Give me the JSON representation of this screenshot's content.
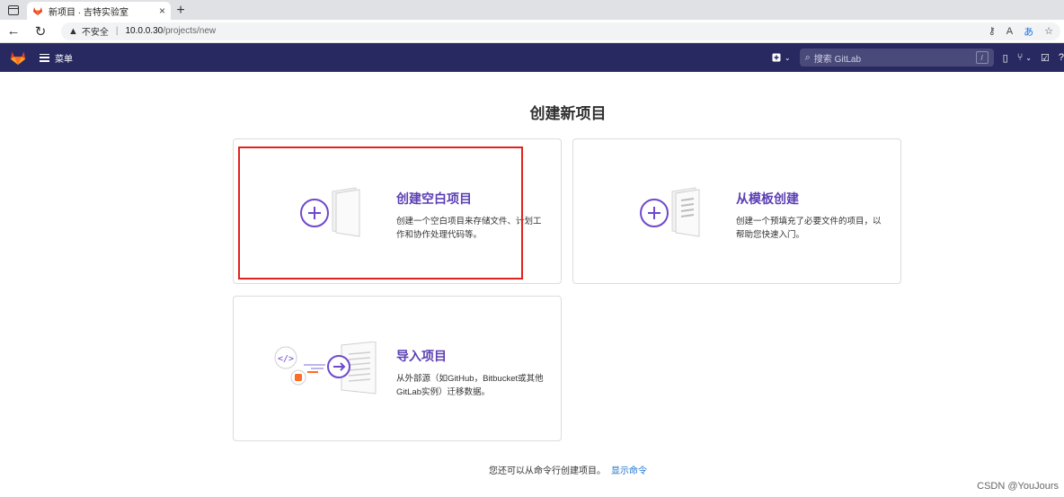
{
  "browser": {
    "tab_title": "新项目 · 吉特实验室",
    "new_tab_symbol": "+",
    "close_symbol": "×",
    "security_label": "不安全",
    "url_host": "10.0.0.30",
    "url_path": "/projects/new"
  },
  "header": {
    "menu_label": "菜单",
    "search_placeholder": "搜索 GitLab",
    "search_shortcut": "/",
    "brand_color": "#292961"
  },
  "main": {
    "title": "创建新项目",
    "cards": [
      {
        "title": "创建空白项目",
        "description": "创建一个空白项目来存储文件、计划工作和协作处理代码等。",
        "icon": "plus-icon"
      },
      {
        "title": "从模板创建",
        "description": "创建一个预填充了必要文件的项目，以帮助您快速入门。",
        "icon": "plus-icon"
      },
      {
        "title": "导入项目",
        "description": "从外部源（如GitHub，Bitbucket或其他GitLab实例）迁移数据。",
        "icon": "arrow-right-icon"
      }
    ],
    "footer_text": "您还可以从命令行创建项目。",
    "footer_link": "显示命令"
  },
  "watermark": "CSDN @YouJours"
}
